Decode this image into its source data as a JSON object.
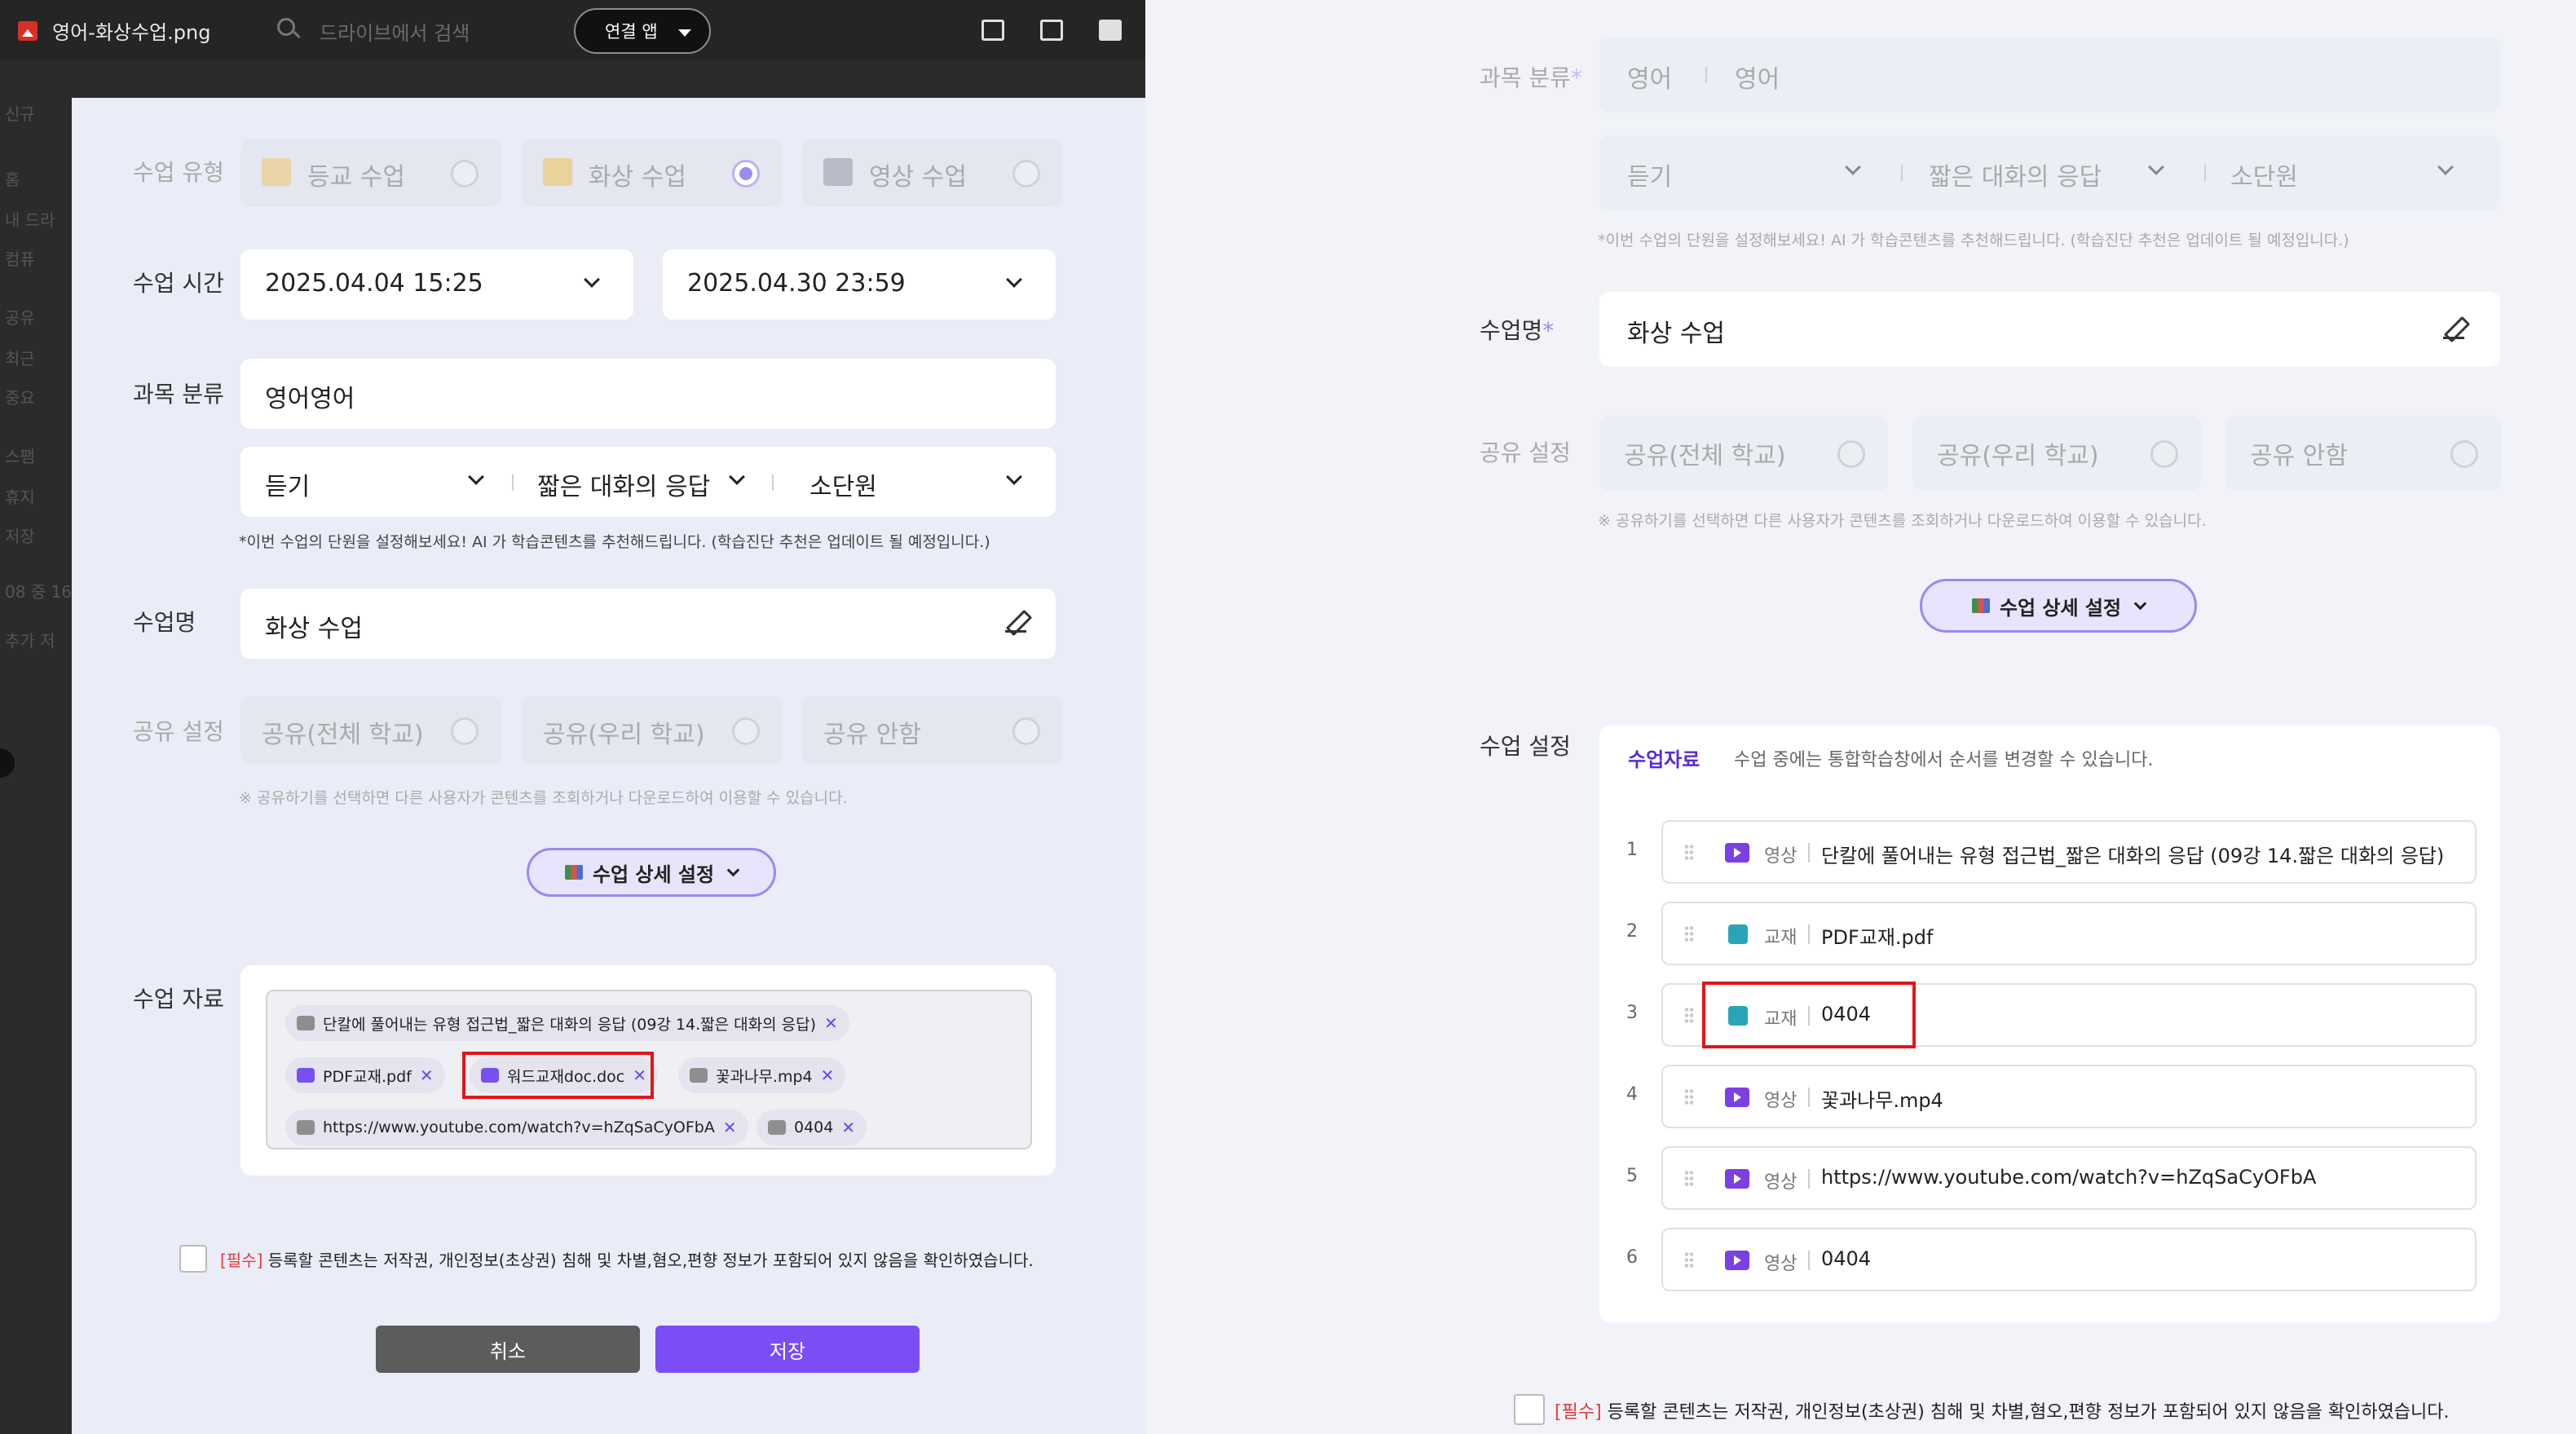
{
  "viewer": {
    "file_name": "영어-화상수업.png",
    "search_placeholder": "드라이브에서 검색",
    "connect_app": "연결 앱"
  },
  "sidebar_faded": [
    "신규",
    "홈",
    "내 드라",
    "컴퓨",
    "공유",
    "최근",
    "중요",
    "스팸",
    "휴지",
    "저장",
    "08 중 16",
    "추가 저"
  ],
  "left_form": {
    "class_type_label": "수업 유형",
    "class_types": [
      {
        "label": "등교 수업",
        "selected": false
      },
      {
        "label": "화상 수업",
        "selected": true
      },
      {
        "label": "영상 수업",
        "selected": false
      }
    ],
    "class_time_label": "수업 시간",
    "start_time": "2025.04.04 15:25",
    "end_time": "2025.04.30 23:59",
    "subject_label": "과목 분류",
    "subject_value": "영어영어",
    "unit": {
      "area": "듣기",
      "type": "짧은 대화의 응답",
      "sub": "소단원"
    },
    "unit_note": "*이번 수업의 단원을 설정해보세요! AI 가 학습콘텐츠를 추천해드립니다. (학습진단 추천은 업데이트 될 예정입니다.)",
    "class_name_label": "수업명",
    "class_name": "화상 수업",
    "share_label": "공유 설정",
    "share_options": [
      "공유(전체 학교)",
      "공유(우리 학교)",
      "공유 안함"
    ],
    "share_note": "※ 공유하기를 선택하면 다른 사용자가 콘텐츠를 조회하거나 다운로드하여 이용할 수 있습니다.",
    "detail_button": "수업 상세 설정",
    "materials_label": "수업 자료",
    "chips": [
      {
        "type": "video",
        "name": "단칼에 풀어내는 유형 접근법_짧은 대화의 응답 (09강 14.짧은 대화의 응답)"
      },
      {
        "type": "book",
        "name": "PDF교재.pdf"
      },
      {
        "type": "book",
        "name": "워드교재doc.doc"
      },
      {
        "type": "video",
        "name": "꽃과나무.mp4"
      },
      {
        "type": "video",
        "name": "https://www.youtube.com/watch?v=hZqSaCyOFbA"
      },
      {
        "type": "video",
        "name": "0404"
      }
    ],
    "required_tag": "[필수]",
    "consent": "등록할 콘텐츠는 저작권, 개인정보(초상권) 침해 및 차별,혐오,편향 정보가 포함되어 있지 않음을 확인하였습니다.",
    "cancel": "취소",
    "save": "저장"
  },
  "right_form": {
    "subject_label": "과목 분류",
    "subject_a": "영어",
    "subject_b": "영어",
    "unit": {
      "area": "듣기",
      "type": "짧은 대화의 응답",
      "sub": "소단원"
    },
    "unit_note": "*이번 수업의 단원을 설정해보세요! AI 가 학습콘텐츠를 추천해드립니다. (학습진단 추천은 업데이트 될 예정입니다.)",
    "class_name_label": "수업명",
    "class_name": "화상 수업",
    "share_label": "공유 설정",
    "share_options": [
      "공유(전체 학교)",
      "공유(우리 학교)",
      "공유 안함"
    ],
    "share_note": "※ 공유하기를 선택하면 다른 사용자가 콘텐츠를 조회하거나 다운로드하여 이용할 수 있습니다.",
    "detail_button": "수업 상세 설정",
    "settings_label": "수업 설정",
    "materials_tab": "수업자료",
    "materials_hint": "수업 중에는 통합학습창에서 순서를 변경할 수 있습니다.",
    "materials": [
      {
        "num": "1",
        "type": "영상",
        "icon": "video",
        "name": "단칼에 풀어내는 유형 접근법_짧은 대화의 응답 (09강 14.짧은 대화의 응답)"
      },
      {
        "num": "2",
        "type": "교재",
        "icon": "book",
        "name": "PDF교재.pdf"
      },
      {
        "num": "3",
        "type": "교재",
        "icon": "book",
        "name": "0404"
      },
      {
        "num": "4",
        "type": "영상",
        "icon": "video",
        "name": "꽃과나무.mp4"
      },
      {
        "num": "5",
        "type": "영상",
        "icon": "video",
        "name": "https://www.youtube.com/watch?v=hZqSaCyOFbA"
      },
      {
        "num": "6",
        "type": "영상",
        "icon": "video",
        "name": "0404"
      }
    ],
    "required_tag": "[필수]",
    "consent": "등록할 콘텐츠는 저작권, 개인정보(초상권) 침해 및 차별,혐오,편향 정보가 포함되어 있지 않음을 확인하였습니다."
  },
  "colors": {
    "accent_purple": "#7b4df5",
    "highlight_red": "#e0161c",
    "required_red": "#e23b3b",
    "video_icon": "#7b3fe4",
    "book_icon": "#2aa5b7"
  }
}
